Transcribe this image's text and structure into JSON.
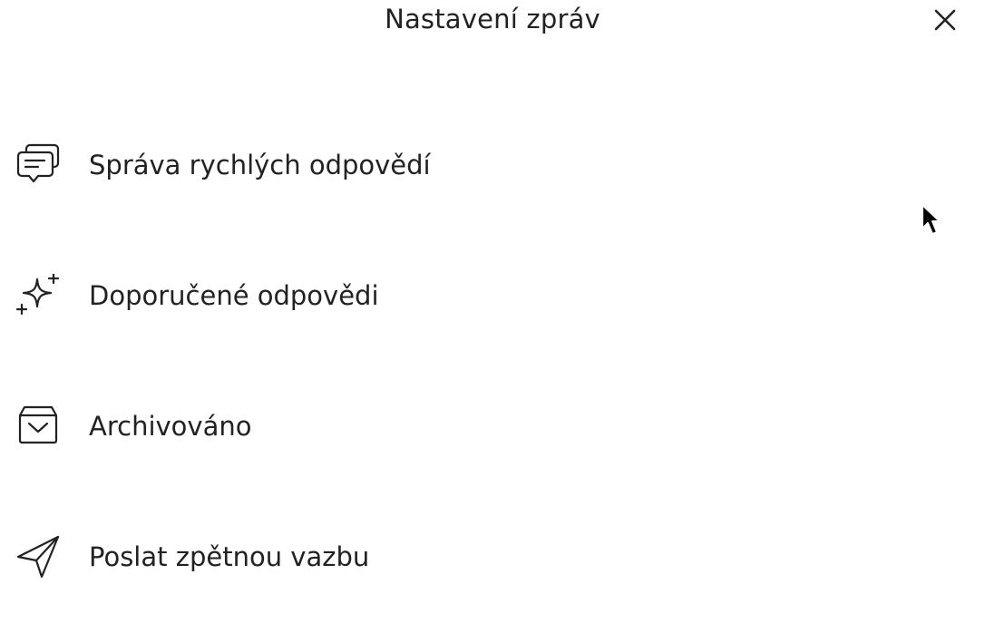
{
  "header": {
    "title": "Nastavení zpráv",
    "close_icon": "close-icon"
  },
  "menu": {
    "items": [
      {
        "label": "Správa rychlých odpovědí",
        "icon": "chat-bubbles-icon"
      },
      {
        "label": "Doporučené odpovědi",
        "icon": "sparkles-icon"
      },
      {
        "label": "Archivováno",
        "icon": "archive-box-icon"
      },
      {
        "label": "Poslat zpětnou vazbu",
        "icon": "paper-plane-icon"
      }
    ]
  },
  "colors": {
    "text": "#222222",
    "background": "#ffffff"
  }
}
